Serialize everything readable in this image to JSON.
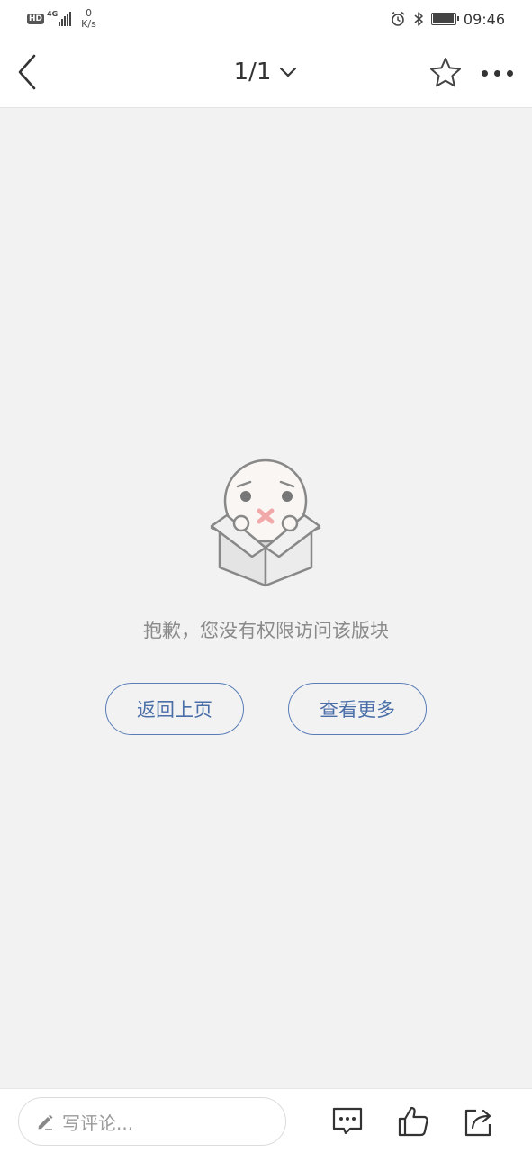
{
  "status_bar": {
    "hd_badge": "HD",
    "network_type": "4G",
    "speed_value": "0",
    "speed_unit": "K/s",
    "time": "09:46",
    "battery_level": 0.95,
    "icons": [
      "alarm-icon",
      "bluetooth-icon",
      "battery-icon",
      "signal-icon"
    ]
  },
  "nav": {
    "page_indicator": "1/1",
    "icons": [
      "back-arrow-icon",
      "chevron-down-icon",
      "star-icon",
      "more-dots-icon"
    ]
  },
  "empty_state": {
    "message": "抱歉，您没有权限访问该版块",
    "back_button_label": "返回上页",
    "more_button_label": "查看更多"
  },
  "bottom_bar": {
    "comment_placeholder": "写评论...",
    "icons": [
      "pencil-icon",
      "comments-icon",
      "thumbs-up-icon",
      "share-icon"
    ]
  },
  "colors": {
    "page_background": "#f2f2f2",
    "button_accent": "#5a7db8",
    "message_text": "#8a8a8a"
  }
}
